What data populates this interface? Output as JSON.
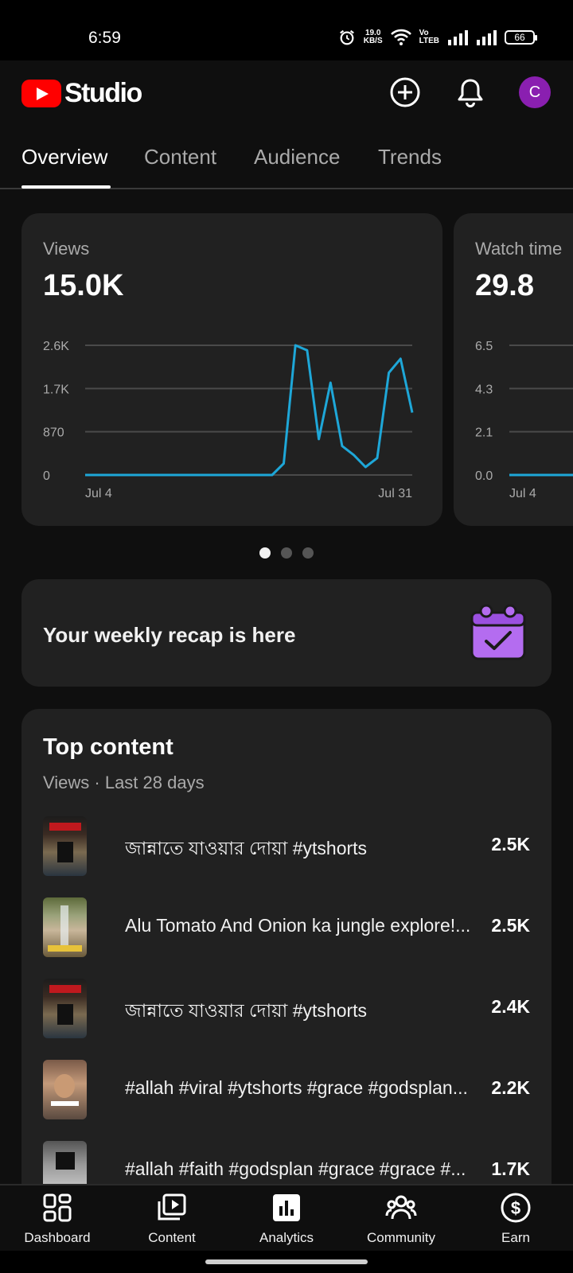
{
  "status": {
    "time": "6:59",
    "net_speed_top": "19.0",
    "net_speed_bottom": "KB/S",
    "volte_top": "Vo",
    "volte_bottom": "LTEB",
    "battery": "66"
  },
  "header": {
    "logo_text": "Studio",
    "avatar_letter": "C"
  },
  "tabs": [
    "Overview",
    "Content",
    "Audience",
    "Trends"
  ],
  "views_card": {
    "label": "Views",
    "value": "15.0K"
  },
  "watch_card": {
    "label": "Watch time",
    "value": "29.8"
  },
  "chart_data": [
    {
      "type": "line",
      "title": "Views",
      "x_labels": [
        "Jul 4",
        "Jul 31"
      ],
      "y_ticks": [
        "0",
        "870",
        "1.7K",
        "2.6K"
      ],
      "ylim": [
        0,
        2600
      ],
      "grid": true,
      "color": "#1ea7d8",
      "values": [
        0,
        0,
        0,
        0,
        0,
        0,
        0,
        0,
        0,
        0,
        0,
        0,
        0,
        0,
        0,
        0,
        0,
        230,
        2600,
        2500,
        720,
        1850,
        580,
        400,
        160,
        340,
        2050,
        2330,
        1250
      ]
    },
    {
      "type": "line",
      "title": "Watch time",
      "x_labels": [
        "Jul 4"
      ],
      "y_ticks": [
        "0.0",
        "2.1",
        "4.3",
        "6.5"
      ],
      "ylim": [
        0,
        6.5
      ],
      "grid": true,
      "color": "#1ea7d8",
      "values": [
        0,
        0,
        0,
        0
      ]
    }
  ],
  "recap": {
    "text": "Your weekly recap is here"
  },
  "top_content": {
    "title": "Top content",
    "subtitle": "Views · Last 28 days",
    "items": [
      {
        "title": "জান্নাতে যাওয়ার দোয়া #ytshorts",
        "value": "2.5K"
      },
      {
        "title": "Alu Tomato And Onion ka jungle explore!...",
        "value": "2.5K"
      },
      {
        "title": "জান্নাতে যাওয়ার দোয়া #ytshorts",
        "value": "2.4K"
      },
      {
        "title": "#allah #viral #ytshorts #grace #godsplan...",
        "value": "2.2K"
      },
      {
        "title": "#allah #faith #godsplan #grace #grace #...",
        "value": "1.7K"
      }
    ]
  },
  "bottom_nav": [
    "Dashboard",
    "Content",
    "Analytics",
    "Community",
    "Earn"
  ],
  "colors": {
    "accent": "#ff0000",
    "chart_line": "#1ea7d8",
    "avatar": "#8a1fb0",
    "recap_icon": "#b46cf0"
  }
}
